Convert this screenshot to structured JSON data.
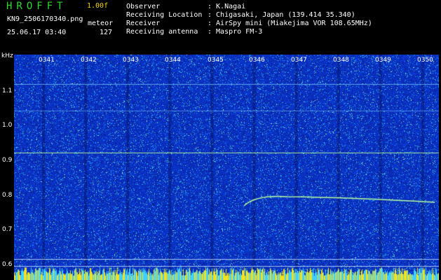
{
  "header": {
    "logo": "HROFFT",
    "version": "1.00f",
    "filename": "KN9_2506170340.png",
    "mode": "meteor",
    "datetime": "25.06.17 03:40",
    "count": "127",
    "info_labels": [
      "Observer",
      "Receiving Location",
      "Receiver",
      "Receiving antenna"
    ],
    "info_values": [
      ": K.Nagai",
      ": Chigasaki, Japan (139.414 35.340)",
      ": AirSpy mini (Miakejima VOR 108.65MHz)",
      ": Maspro FM-3"
    ]
  },
  "axes": {
    "y_unit": "kHz",
    "y_ticks": [
      "1.1",
      "1.0",
      "0.9",
      "0.8",
      "0.7",
      "0.6"
    ],
    "x_ticks": [
      "0341",
      "0342",
      "0343",
      "0344",
      "0345",
      "0346",
      "0347",
      "0348",
      "0349",
      "0350"
    ]
  },
  "colors": {
    "background": "#000000",
    "spectrogram_base": "#0b2aa8",
    "signal": "#b8ff9a",
    "header_text": "#ffffff",
    "logo": "#2fd82f"
  }
}
